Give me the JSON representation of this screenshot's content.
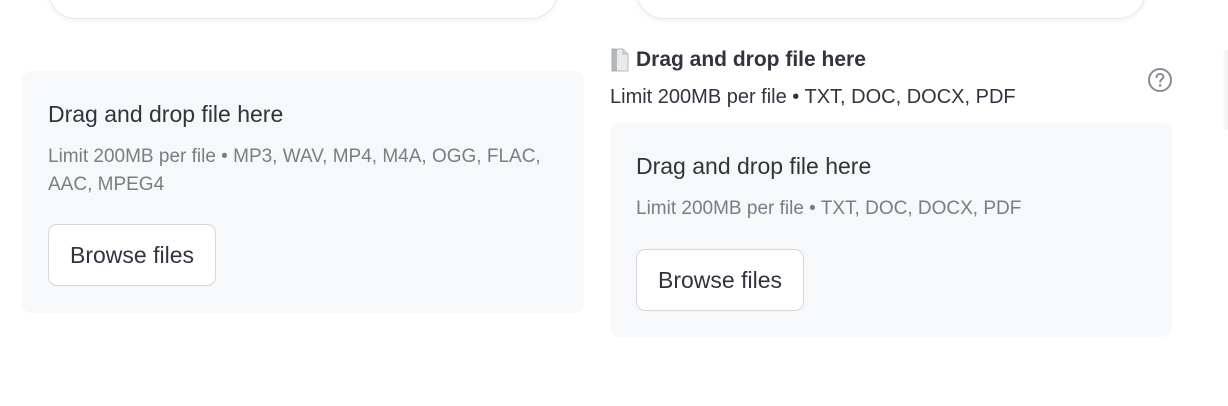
{
  "left_uploader": {
    "dropzone_title": "Drag and drop file here",
    "limit_text": "Limit 200MB per file • MP3, WAV, MP4, M4A, OGG, FLAC, AAC, MPEG4",
    "browse_label": "Browse files"
  },
  "right_uploader": {
    "label_icon": "document-icon",
    "label": "Drag and drop file here",
    "sublabel": "Limit 200MB per file • TXT, DOC, DOCX, PDF",
    "help_icon": "question-circle-icon",
    "dropzone_title": "Drag and drop file here",
    "limit_text": "Limit 200MB per file • TXT, DOC, DOCX, PDF",
    "browse_label": "Browse files"
  },
  "colors": {
    "dropzone_bg": "#f7f8fa",
    "text_primary": "#31333f",
    "text_secondary": "#7a7d87",
    "button_border": "#d4d6db"
  }
}
